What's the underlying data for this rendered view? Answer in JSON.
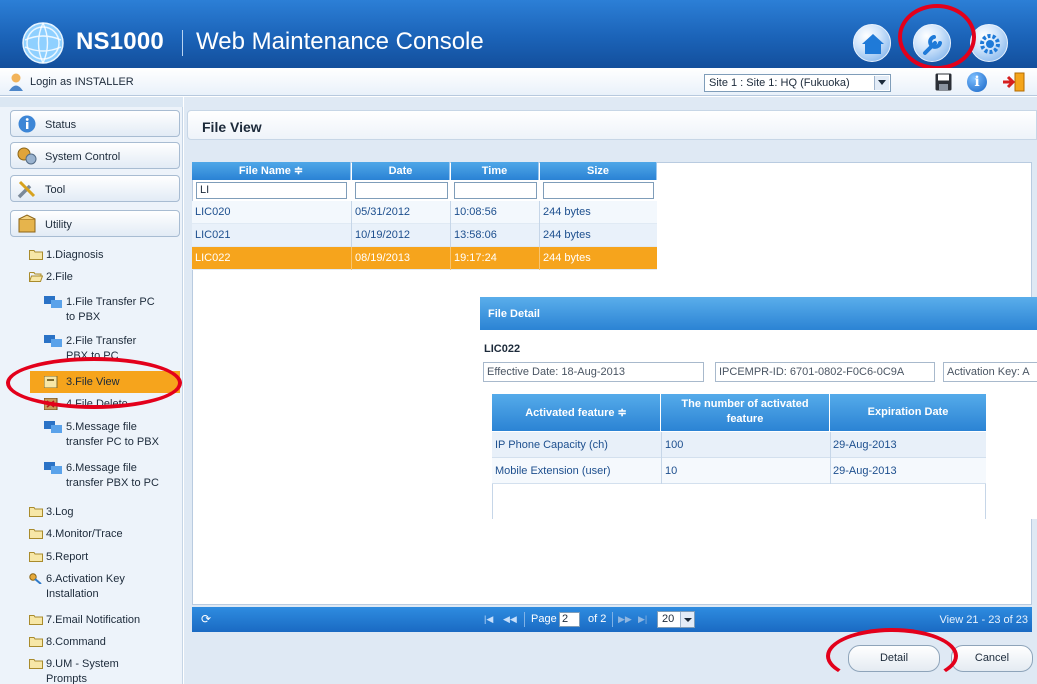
{
  "app": {
    "product": "NS1000",
    "console_title": "Web Maintenance Console"
  },
  "header_icons": [
    "home-icon",
    "tool-wrench-icon",
    "settings-gear-icon"
  ],
  "login": {
    "text": "Login as INSTALLER",
    "site_value": "Site 1 : Site 1: HQ (Fukuoka)"
  },
  "sidebar": {
    "sections": [
      {
        "label": "Status",
        "icon": "status-icon"
      },
      {
        "label": "System Control",
        "icon": "system-control-icon"
      },
      {
        "label": "Tool",
        "icon": "tool-icon"
      },
      {
        "label": "Utility",
        "icon": "utility-icon"
      }
    ],
    "tree": {
      "diagnosis": "1.Diagnosis",
      "file": "2.File",
      "file_items": [
        {
          "line1": "1.File Transfer PC",
          "line2": "to PBX"
        },
        {
          "line1": "2.File Transfer",
          "line2": "PBX to PC"
        },
        {
          "line1": "3.File View",
          "line2": ""
        },
        {
          "line1": "4.File Delete",
          "line2": ""
        },
        {
          "line1": "5.Message file",
          "line2": "transfer PC to PBX"
        },
        {
          "line1": "6.Message file",
          "line2": "transfer PBX to PC"
        }
      ],
      "log": "3.Log",
      "monitor": "4.Monitor/Trace",
      "report": "5.Report",
      "activation_1": "6.Activation Key",
      "activation_2": "Installation",
      "email": "7.Email Notification",
      "command": "8.Command",
      "um_1": "9.UM - System",
      "um_2": "Prompts"
    }
  },
  "main": {
    "title": "File View",
    "grid": {
      "columns": [
        "File Name ≑",
        "Date",
        "Time",
        "Size"
      ],
      "filters": [
        "LI",
        "",
        "",
        ""
      ],
      "rows": [
        [
          "LIC020",
          "05/31/2012",
          "10:08:56",
          "244 bytes"
        ],
        [
          "LIC021",
          "10/19/2012",
          "13:58:06",
          "244 bytes"
        ],
        [
          "LIC022",
          "08/19/2013",
          "19:17:24",
          "244 bytes"
        ]
      ],
      "selected_row": 2
    },
    "detail": {
      "header": "File Detail",
      "name": "LIC022",
      "effective_date": "Effective Date: 18-Aug-2013",
      "ipcempr_id": "IPCEMPR-ID: 6701-0802-F0C6-0C9A",
      "activation_key": "Activation Key: A",
      "columns": [
        "Activated feature ≑",
        "The number of activated feature",
        "Expiration Date"
      ],
      "rows": [
        [
          "IP Phone Capacity (ch)",
          "100",
          "29-Aug-2013"
        ],
        [
          "Mobile Extension (user)",
          "10",
          "29-Aug-2013"
        ]
      ]
    },
    "pager": {
      "page_label": "Page",
      "page_value": "2",
      "of_label": "of 2",
      "page_size": "20",
      "view_text": "View 21 - 23 of 23"
    }
  },
  "buttons": {
    "detail": "Detail",
    "cancel": "Cancel"
  },
  "colors": {
    "header_blue": "#1b63b8",
    "grid_header_blue": "#2a82d4",
    "selection_orange": "#f6a41c",
    "annotation_red": "#e3001b"
  }
}
